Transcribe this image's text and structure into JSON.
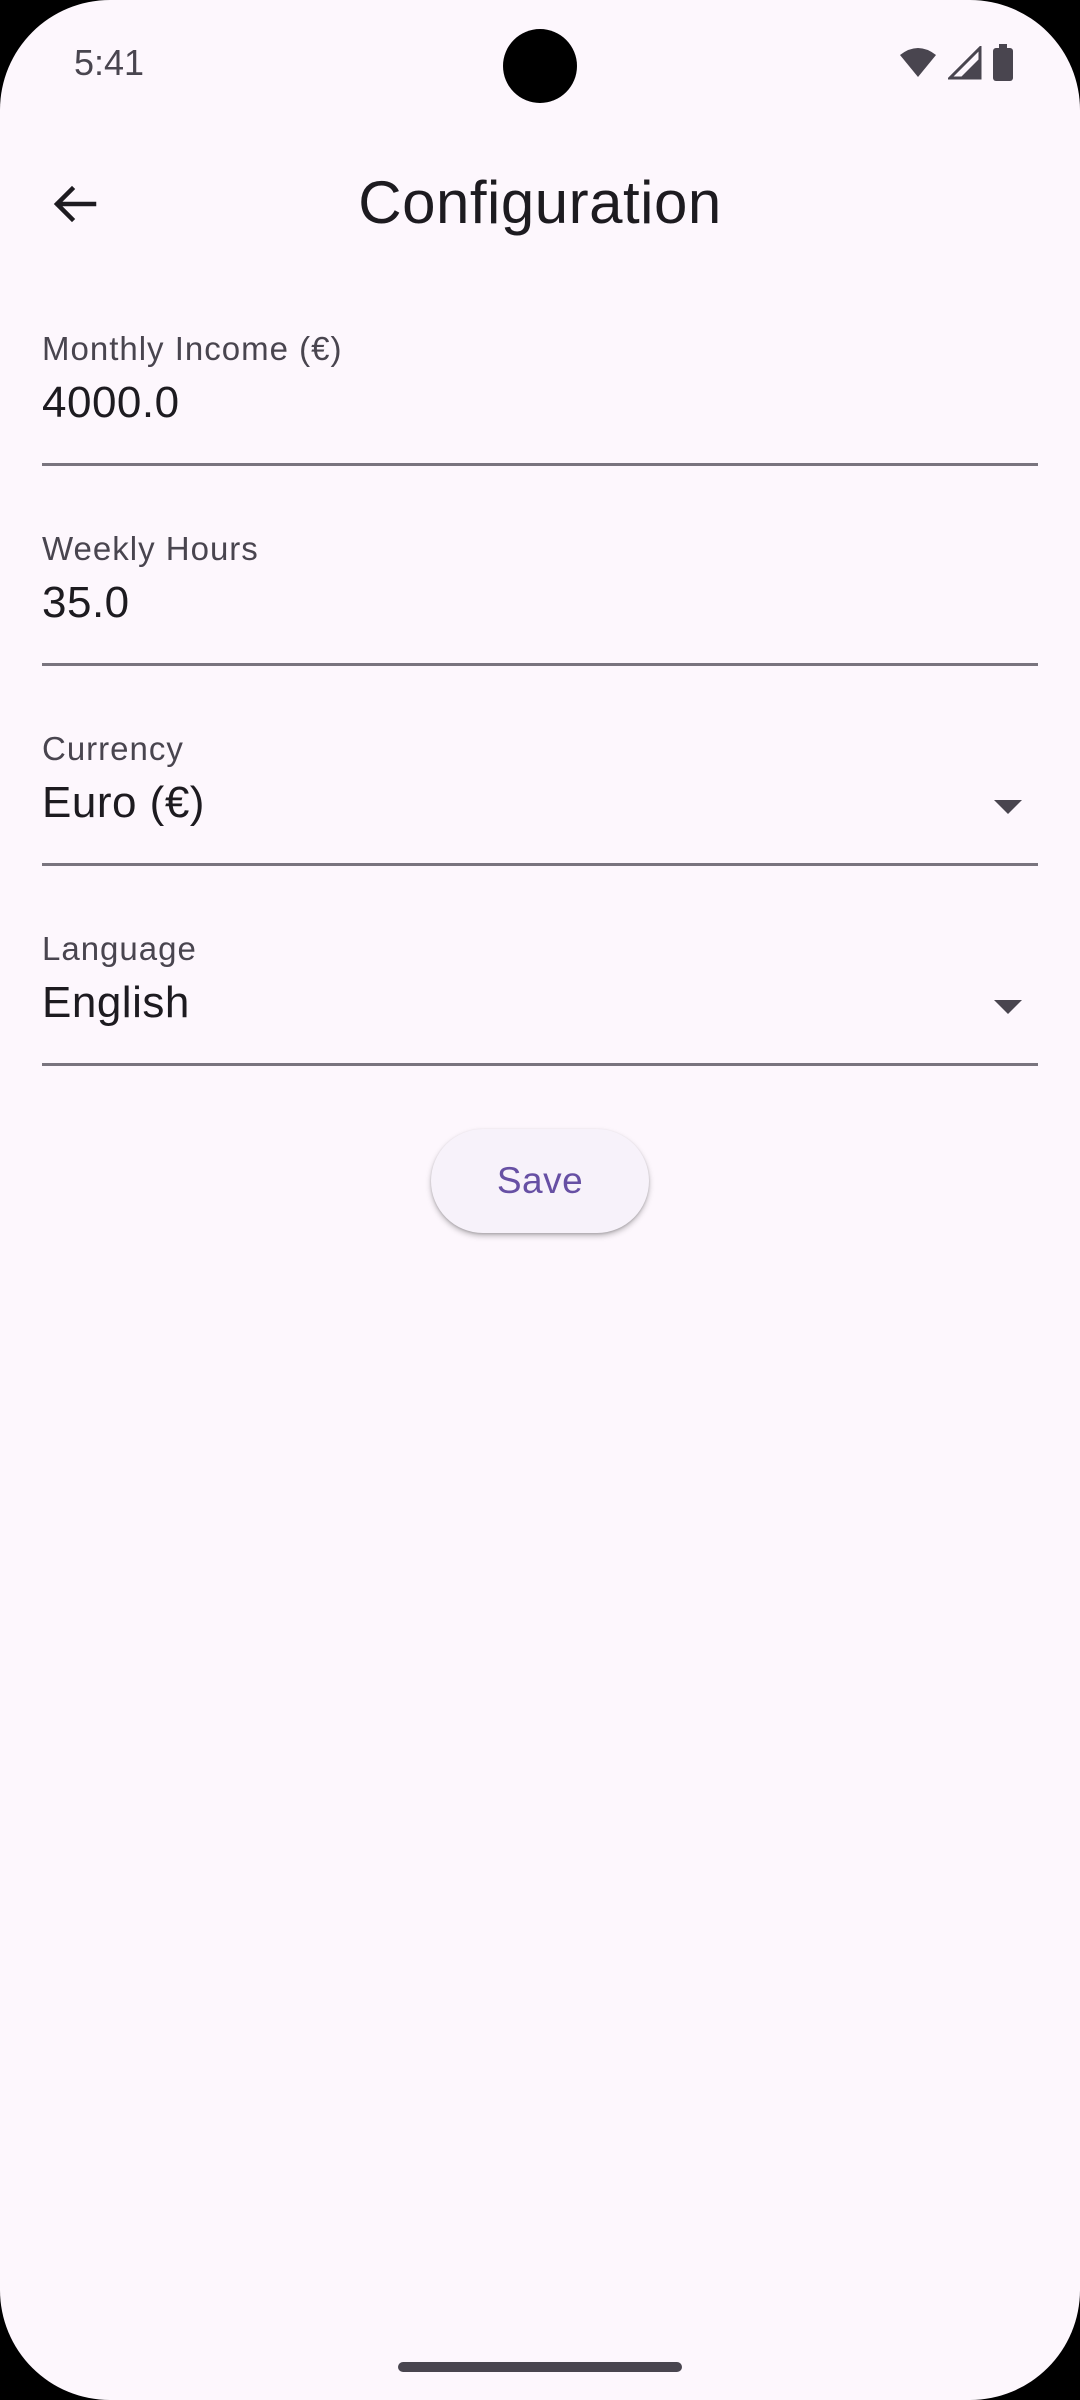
{
  "status_bar": {
    "time": "5:41",
    "icons": [
      "wifi-icon",
      "cell-signal-icon",
      "battery-icon"
    ]
  },
  "app_bar": {
    "back_icon": "arrow-back-icon",
    "title": "Configuration"
  },
  "form": {
    "monthly_income": {
      "label": "Monthly Income (€)",
      "value": "4000.0"
    },
    "weekly_hours": {
      "label": "Weekly Hours",
      "value": "35.0"
    },
    "currency": {
      "label": "Currency",
      "value": "Euro (€)"
    },
    "language": {
      "label": "Language",
      "value": "English"
    },
    "save_label": "Save"
  },
  "colors": {
    "background": "#fdf7fd",
    "accent": "#6750a4",
    "text": "#1d1b20",
    "label": "#49454f",
    "underline": "#79747e"
  }
}
